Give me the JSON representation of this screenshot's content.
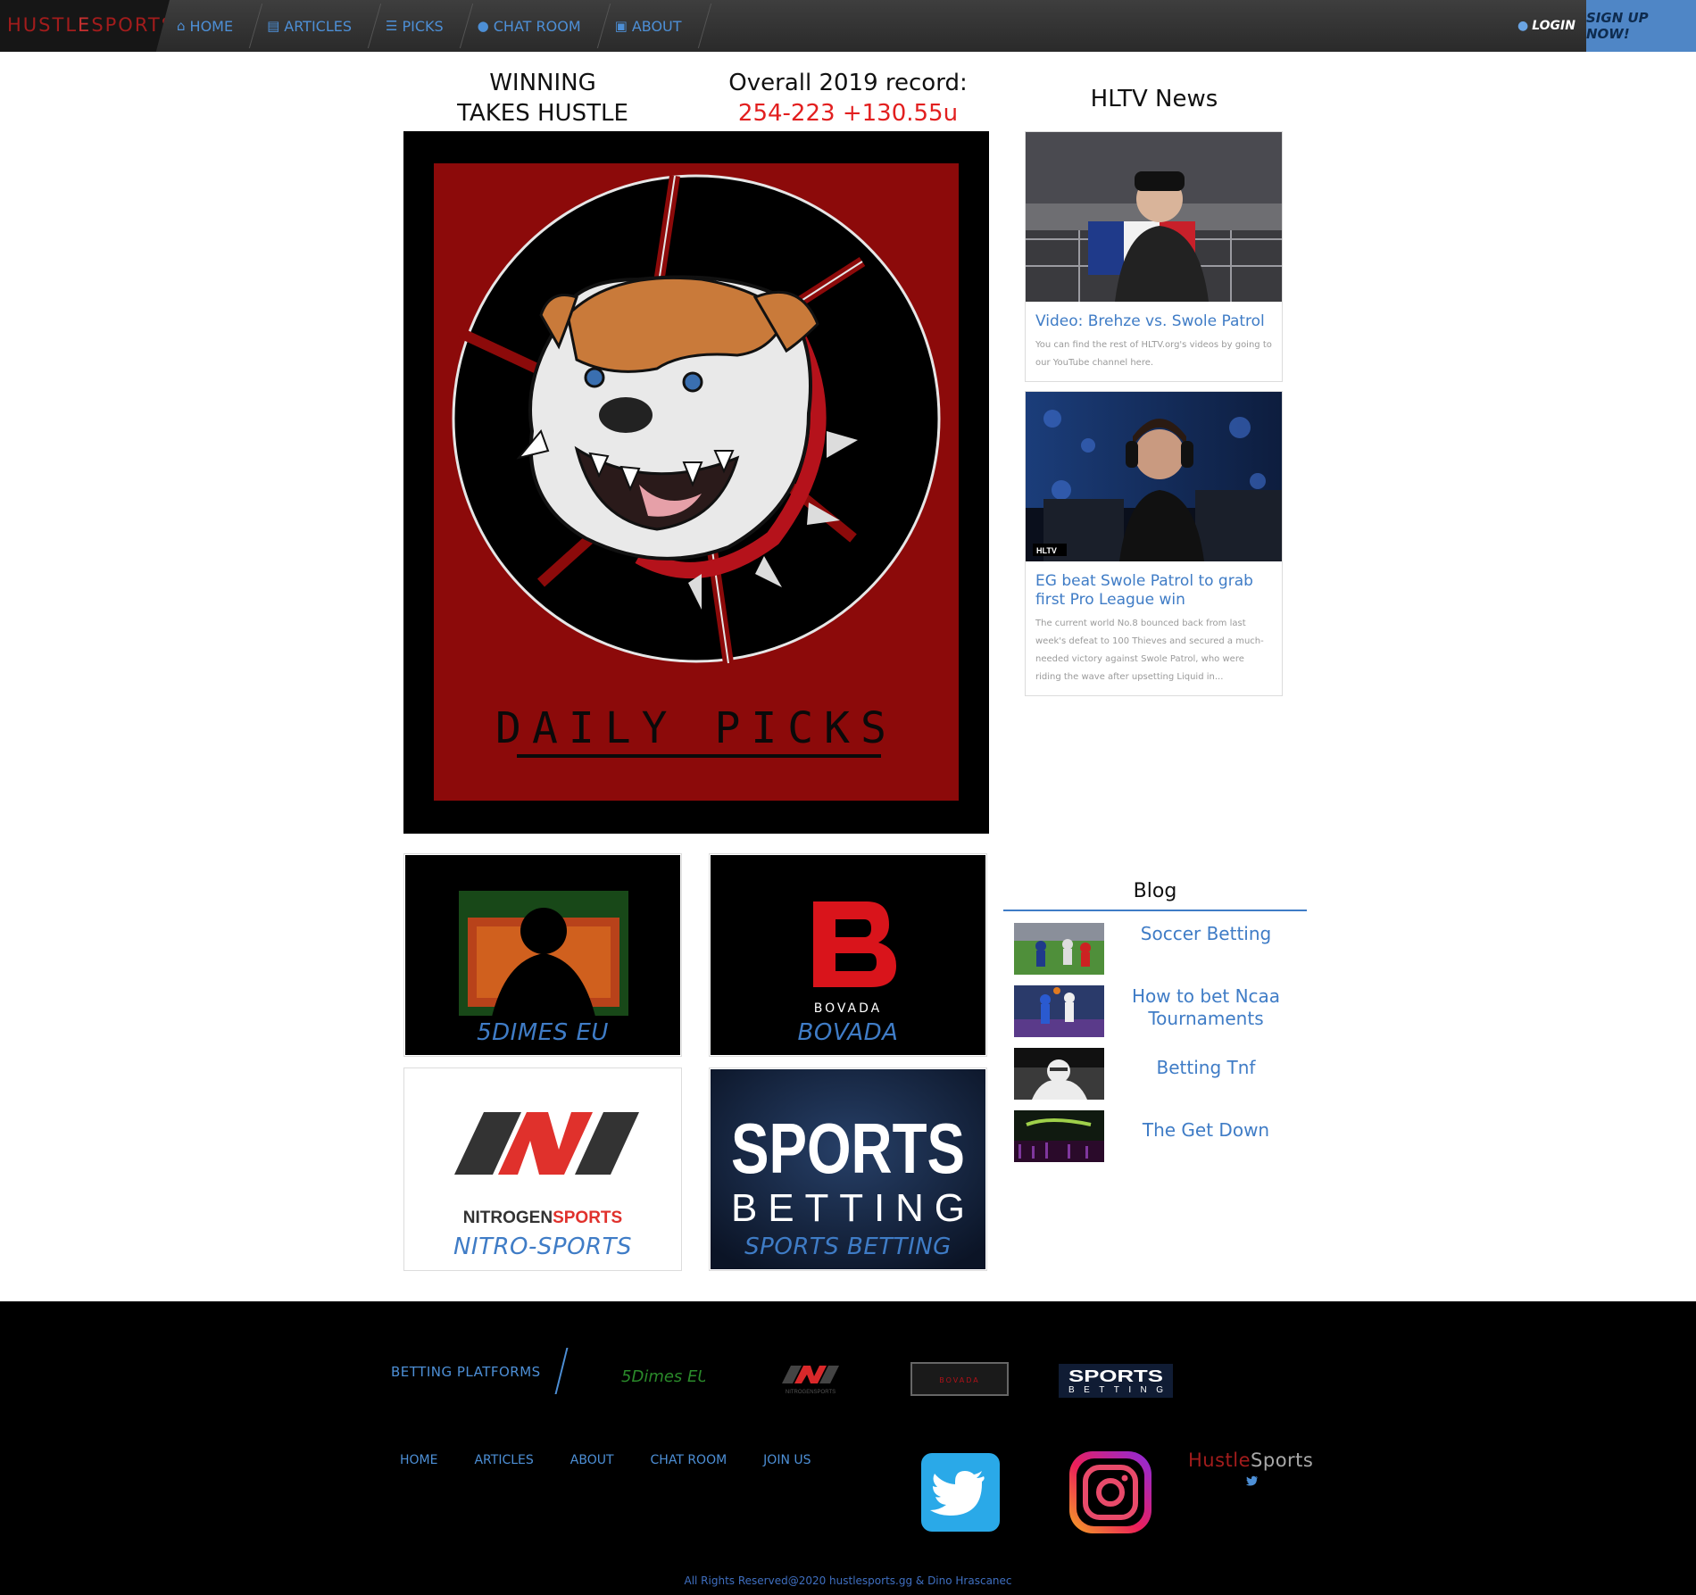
{
  "nav": {
    "brand_part1": "HUSTL",
    "brand_part2": "E",
    "brand_part3": "SPORTS",
    "items": [
      {
        "label": "HOME",
        "icon": "home-icon"
      },
      {
        "label": "ARTICLES",
        "icon": "file-icon"
      },
      {
        "label": "PICKS",
        "icon": "list-icon"
      },
      {
        "label": "CHAT ROOM",
        "icon": "chat-icon"
      },
      {
        "label": "ABOUT",
        "icon": "id-card-icon"
      }
    ],
    "login": "LOGIN",
    "signup": "SIGN UP NOW!"
  },
  "headline": {
    "winning_line1": "WINNING",
    "winning_line2": "TAKES HUSTLE",
    "record_label": "Overall 2019 record:",
    "record_value": "254-223 +130.55u"
  },
  "hero": {
    "caption": "DAILY PICKS"
  },
  "hltv": {
    "title": "HLTV News",
    "cards": [
      {
        "title": "Video: Brehze vs. Swole Patrol",
        "desc": "You can find the rest of HLTV.org's videos by going to our YouTube channel here."
      },
      {
        "title": "EG beat Swole Patrol to grab first Pro League win",
        "desc": "The current world No.8 bounced back from last week's defeat to 100 Thieves and secured a much-needed victory against Swole Patrol, who were riding the wave after upsetting Liquid in..."
      }
    ]
  },
  "sponsors": [
    {
      "caption": "5DIMES EU"
    },
    {
      "caption": "BOVADA",
      "logo_text": "BOVADA"
    },
    {
      "caption": "NITRO-SPORTS",
      "logo_text_a": "NITROGEN",
      "logo_text_b": "SPORTS"
    },
    {
      "caption": "SPORTS BETTING",
      "logo_line1": "SPORTS",
      "logo_line2": "BETTING"
    }
  ],
  "blog": {
    "title": "Blog",
    "items": [
      {
        "label": "Soccer Betting"
      },
      {
        "label": "How to bet Ncaa Tournaments"
      },
      {
        "label": "Betting Tnf"
      },
      {
        "label": "The Get Down"
      }
    ]
  },
  "footer": {
    "platforms_label": "BETTING PLATFORMS",
    "platforms": [
      {
        "name": "5Dimes EU"
      },
      {
        "name": "NITROGENSPORTS"
      },
      {
        "name": "BOVADA"
      },
      {
        "name_line1": "SPORTS",
        "name_line2": "BETTING"
      }
    ],
    "links": [
      "HOME",
      "ARTICLES",
      "ABOUT",
      "CHAT ROOM",
      "JOIN US"
    ],
    "brand_part1": "Hustle",
    "brand_part2": "Sports",
    "copyright": "All Rights Reserved@2020 hustlesports.gg & Dino Hrascanec"
  },
  "colors": {
    "accent_blue": "#3f7cc6",
    "brand_red": "#a31c1c",
    "record_red": "#e21f1f",
    "signup_bg": "#4f86c6"
  }
}
